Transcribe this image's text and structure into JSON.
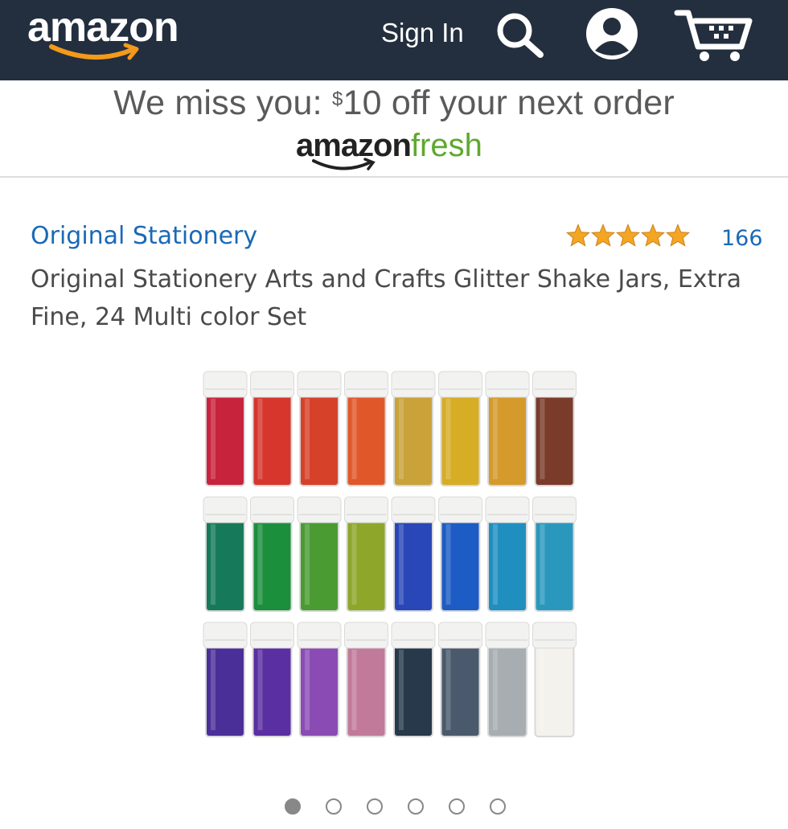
{
  "header": {
    "logo_text": "amazon",
    "sign_in_label": "Sign In",
    "icons": [
      "search-icon",
      "account-icon",
      "cart-icon"
    ]
  },
  "banner": {
    "promo_prefix": "We miss you: ",
    "promo_currency": "$",
    "promo_suffix": "10 off your next order",
    "brand_part1": "amazon",
    "brand_part2": "fresh"
  },
  "product": {
    "brand": "Original Stationery",
    "rating_stars": 5,
    "review_count": "166",
    "title": "Original Stationery Arts and Crafts Glitter Shake Jars, Extra Fine, 24 Multi color Set",
    "image": {
      "rows": [
        [
          "#c8233c",
          "#d6362c",
          "#d6412a",
          "#e0582a",
          "#c9a23a",
          "#d7ad26",
          "#d49a2c",
          "#7b3b2a"
        ],
        [
          "#167a5a",
          "#1c8f3d",
          "#4b9b33",
          "#8ea62a",
          "#2a47b8",
          "#1c5cc4",
          "#1f8fc0",
          "#2a98bd"
        ],
        [
          "#4b2f98",
          "#5a2fa2",
          "#8a4cb4",
          "#c27a9a",
          "#27394a",
          "#4a5a6c",
          "#a8adb2",
          "#f4f2ec"
        ]
      ]
    },
    "carousel": {
      "total": 6,
      "active": 1
    }
  },
  "colors": {
    "header_bg": "#232f3e",
    "link": "#1b69b5",
    "star": "#f4a623",
    "fresh_green": "#5ea92e",
    "smile_orange": "#f49a1a"
  }
}
